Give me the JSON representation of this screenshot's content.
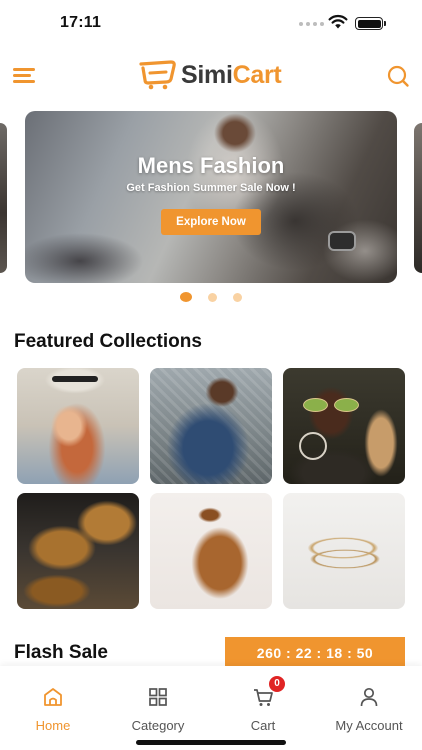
{
  "status_bar": {
    "time": "17:11"
  },
  "header": {
    "logo_text_1": "Simi",
    "logo_text_2": "Cart",
    "menu_icon": "hamburger-menu-icon",
    "search_icon": "search-icon"
  },
  "banner": {
    "title": "Mens Fashion",
    "subtitle": "Get Fashion Summer Sale Now !",
    "button_label": "Explore Now",
    "slide_count": 3,
    "active_slide": 1
  },
  "featured": {
    "title": "Featured Collections",
    "items": [
      {
        "name": "woman-with-hat"
      },
      {
        "name": "man-in-patterned-shirt"
      },
      {
        "name": "woman-with-sunglasses"
      },
      {
        "name": "leather-boots"
      },
      {
        "name": "leather-bag"
      },
      {
        "name": "gold-bracelets"
      }
    ]
  },
  "flash_sale": {
    "title": "Flash Sale",
    "timer": "260 : 22 : 18 : 50"
  },
  "tabbar": {
    "items": [
      {
        "label": "Home",
        "icon": "home-icon"
      },
      {
        "label": "Category",
        "icon": "grid-icon"
      },
      {
        "label": "Cart",
        "icon": "cart-icon",
        "badge": "0"
      },
      {
        "label": "My Account",
        "icon": "user-icon"
      }
    ]
  },
  "colors": {
    "accent": "#f0952f",
    "badge": "#e02424",
    "text": "#111111"
  }
}
